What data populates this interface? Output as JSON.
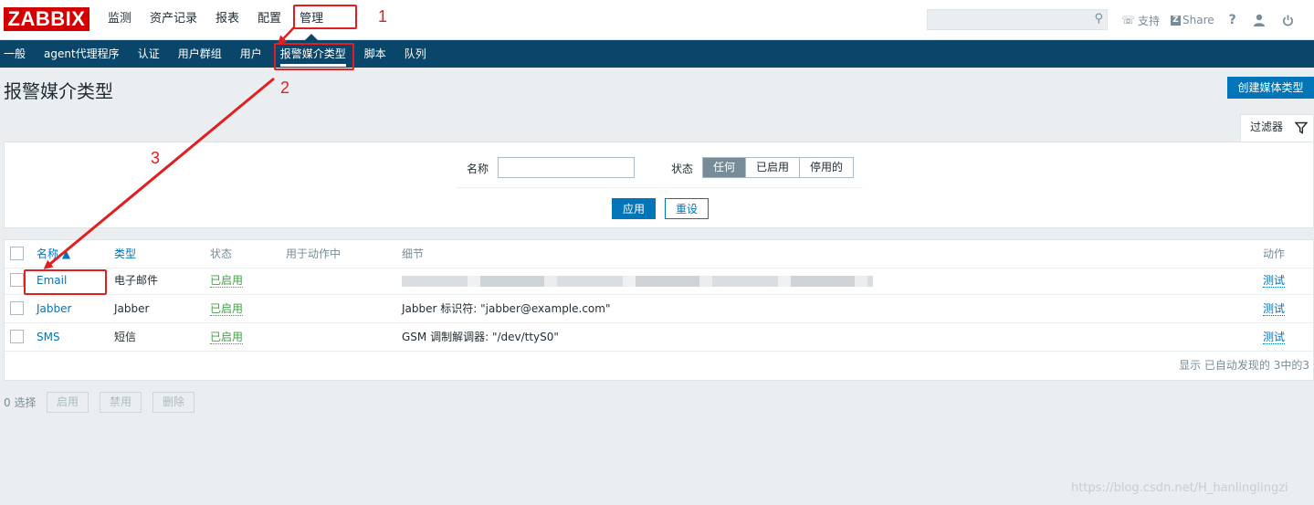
{
  "header": {
    "logo": "ZABBIX",
    "nav": [
      "监测",
      "资产记录",
      "报表",
      "配置",
      "管理"
    ],
    "active_nav": "管理",
    "search": {
      "value": "",
      "placeholder": ""
    },
    "support": "支持",
    "share_badge": "Z",
    "share": "Share",
    "help": "?"
  },
  "subnav": {
    "items": [
      "一般",
      "agent代理程序",
      "认证",
      "用户群组",
      "用户",
      "报警媒介类型",
      "脚本",
      "队列"
    ],
    "active": "报警媒介类型"
  },
  "page": {
    "title": "报警媒介类型",
    "create_button": "创建媒体类型"
  },
  "filter": {
    "tab_label": "过滤器",
    "name_label": "名称",
    "name_value": "",
    "status_label": "状态",
    "status_options": [
      "任何",
      "已启用",
      "停用的"
    ],
    "status_selected": "任何",
    "apply": "应用",
    "reset": "重设"
  },
  "table": {
    "columns": [
      "名称 ▲",
      "类型",
      "状态",
      "用于动作中",
      "细节",
      "动作"
    ],
    "rows": [
      {
        "name": "Email",
        "type": "电子邮件",
        "status": "已启用",
        "used_in_actions": "",
        "details": "",
        "action": "测试"
      },
      {
        "name": "Jabber",
        "type": "Jabber",
        "status": "已启用",
        "used_in_actions": "",
        "details": "Jabber 标识符: \"jabber@example.com\"",
        "action": "测试"
      },
      {
        "name": "SMS",
        "type": "短信",
        "status": "已启用",
        "used_in_actions": "",
        "details": "GSM 调制解调器: \"/dev/ttyS0\"",
        "action": "测试"
      }
    ],
    "footer": "显示 已自动发现的 3中的3"
  },
  "bulk": {
    "selected": "0 选择",
    "buttons": [
      "启用",
      "禁用",
      "删除"
    ]
  },
  "annotations": {
    "n1": "1",
    "n2": "2",
    "n3": "3",
    "color": "#e02020"
  },
  "watermark": "https://blog.csdn.net/H_hanlinglingzi"
}
